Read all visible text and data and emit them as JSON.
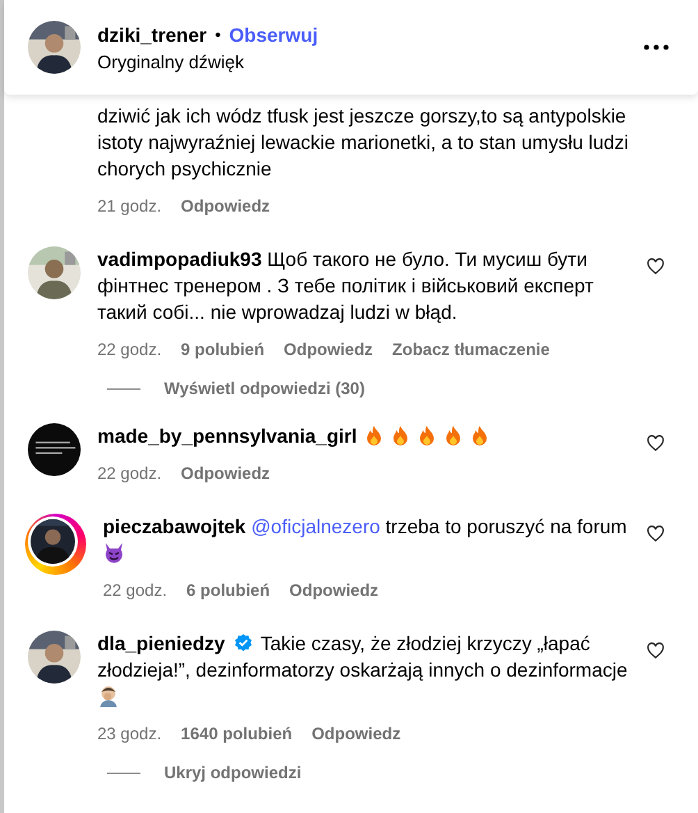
{
  "header": {
    "username": "dziki_trener",
    "separator": "•",
    "follow": "Obserwuj",
    "audio": "Oryginalny dźwięk"
  },
  "comments": [
    {
      "parts": [
        {
          "kind": "text",
          "text": "dziwić jak ich wódz tfusk jest jeszcze gorszy,to są antypolskie istoty najwyraźniej lewackie marionetki, a to stan umysłu ludzi chorych psychicznie"
        }
      ],
      "time": "21 godz.",
      "reply": "Odpowiedz"
    },
    {
      "avatar": {
        "kind": "picture"
      },
      "username": "vadimpopadiuk93",
      "verified": false,
      "parts": [
        {
          "kind": "text",
          "text": "Щоб такого не було. Ти мусиш бути фінтнес тренером . З тебе політик і військовий експерт такий собі... nie wprowadzaj ludzi w błąd."
        }
      ],
      "time": "22 godz.",
      "likes": "9 polubień",
      "reply": "Odpowiedz",
      "translate": "Zobacz tłumaczenie",
      "replies_toggle": "Wyświetl odpowiedzi (30)"
    },
    {
      "avatar": {
        "kind": "dark"
      },
      "username": "made_by_pennsylvania_girl",
      "verified": false,
      "parts": [
        {
          "kind": "fire"
        },
        {
          "kind": "fire"
        },
        {
          "kind": "fire"
        },
        {
          "kind": "fire"
        },
        {
          "kind": "fire"
        }
      ],
      "time": "22 godz.",
      "reply": "Odpowiedz"
    },
    {
      "avatar": {
        "kind": "story"
      },
      "username": "pieczabawojtek",
      "verified": false,
      "parts": [
        {
          "kind": "mention",
          "text": "@oficjalnezero"
        },
        {
          "kind": "text",
          "text": "trzeba to poruszyć na forum"
        },
        {
          "kind": "devil"
        }
      ],
      "time": "22 godz.",
      "likes": "6 polubień",
      "reply": "Odpowiedz"
    },
    {
      "avatar": {
        "kind": "picture"
      },
      "username": "dla_pieniedzy",
      "verified": true,
      "parts": [
        {
          "kind": "text",
          "text": "Takie czasy, że złodziej krzyczy „łapać złodzieja!”, dezinformatorzy oskarżają innych o dezinformacje"
        },
        {
          "kind": "facepalm"
        }
      ],
      "time": "23 godz.",
      "likes": "1640 polubień",
      "reply": "Odpowiedz",
      "replies_toggle": "Ukryj odpowiedzi"
    }
  ]
}
